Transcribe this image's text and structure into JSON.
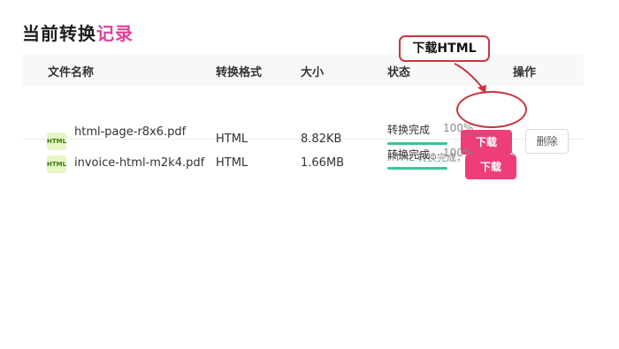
{
  "page": {
    "title_main": "当前转换",
    "title_accent": "记录"
  },
  "table": {
    "headers": {
      "name": "文件名称",
      "format": "转换格式",
      "size": "大小",
      "status": "状态",
      "actions": "操作"
    },
    "rows": [
      {
        "icon_label": "HTML",
        "file_name": "html-page-r8x6.pdf",
        "format": "HTML",
        "size": "8.82KB",
        "status_label": "转换完成",
        "progress_text": "100%",
        "progress": 1.0,
        "status_note": "HTML 转换完成，HTML 下载",
        "download_label": "下载",
        "delete_label": "删除"
      },
      {
        "icon_label": "HTML",
        "file_name": "invoice-html-m2k4.pdf",
        "format": "HTML",
        "size": "1.66MB",
        "status_label": "转换完成",
        "progress_text": "100%",
        "progress": 1.0,
        "download_label": "下载"
      }
    ]
  },
  "annotation": {
    "callout_text": "下载HTML"
  },
  "colors": {
    "accent": "#e0419b",
    "download_button": "#ee3e78",
    "progress": "#35c98f",
    "annotation": "#c9353c"
  }
}
